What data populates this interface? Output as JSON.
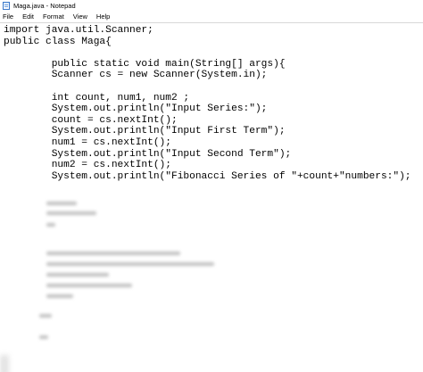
{
  "window": {
    "title": "Maga.java - Notepad"
  },
  "menubar": {
    "items": [
      {
        "id": "file",
        "label": "File"
      },
      {
        "id": "edit",
        "label": "Edit"
      },
      {
        "id": "format",
        "label": "Format"
      },
      {
        "id": "view",
        "label": "View"
      },
      {
        "id": "help",
        "label": "Help"
      }
    ]
  },
  "editor": {
    "lines": [
      "import java.util.Scanner;",
      "public class Maga{",
      "",
      "        public static void main(String[] args){",
      "        Scanner cs = new Scanner(System.in);",
      "",
      "        int count, num1, num2 ;",
      "        System.out.println(\"Input Series:\");",
      "        count = cs.nextInt();",
      "        System.out.println(\"Input First Term\");",
      "        num1 = cs.nextInt();",
      "        System.out.println(\"Input Second Term\");",
      "        num2 = cs.nextInt();",
      "        System.out.println(\"Fibonacci Series of \"+count+\"numbers:\");"
    ]
  },
  "icons": {
    "app": "notepad-icon"
  }
}
